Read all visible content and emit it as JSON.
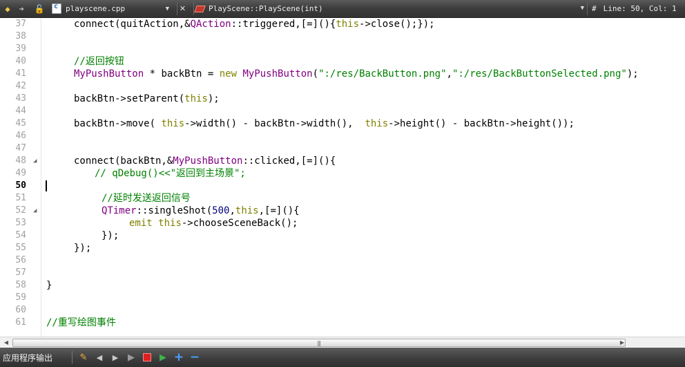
{
  "toolbar": {
    "file_name": "playscene.cpp",
    "symbol": "PlayScene::PlayScene(int)",
    "hash": "#",
    "line_col": "Line: 50, Col: 1"
  },
  "editor": {
    "lines": [
      {
        "n": "37",
        "indent": 46,
        "parts": [
          {
            "t": "connect(quitAction,&",
            "c": "plain"
          },
          {
            "t": "QAction",
            "c": "cls"
          },
          {
            "t": "::triggered,[=](){",
            "c": "plain"
          },
          {
            "t": "this",
            "c": "kw"
          },
          {
            "t": "->close();});",
            "c": "plain"
          }
        ]
      },
      {
        "n": "38",
        "indent": 0,
        "parts": []
      },
      {
        "n": "39",
        "indent": 0,
        "parts": []
      },
      {
        "n": "40",
        "indent": 46,
        "parts": [
          {
            "t": "//返回按钮",
            "c": "cmt"
          }
        ]
      },
      {
        "n": "41",
        "indent": 46,
        "parts": [
          {
            "t": "MyPushButton",
            "c": "cls"
          },
          {
            "t": " * backBtn = ",
            "c": "plain"
          },
          {
            "t": "new",
            "c": "kw"
          },
          {
            "t": " ",
            "c": "plain"
          },
          {
            "t": "MyPushButton",
            "c": "cls"
          },
          {
            "t": "(",
            "c": "plain"
          },
          {
            "t": "\":/res/BackButton.png\"",
            "c": "str"
          },
          {
            "t": ",",
            "c": "plain"
          },
          {
            "t": "\":/res/BackButtonSelected.png\"",
            "c": "str"
          },
          {
            "t": ");",
            "c": "plain"
          }
        ]
      },
      {
        "n": "42",
        "indent": 0,
        "parts": []
      },
      {
        "n": "43",
        "indent": 46,
        "parts": [
          {
            "t": "backBtn->setParent(",
            "c": "plain"
          },
          {
            "t": "this",
            "c": "kw"
          },
          {
            "t": ");",
            "c": "plain"
          }
        ]
      },
      {
        "n": "44",
        "indent": 0,
        "parts": []
      },
      {
        "n": "45",
        "indent": 46,
        "parts": [
          {
            "t": "backBtn->move( ",
            "c": "plain"
          },
          {
            "t": "this",
            "c": "kw"
          },
          {
            "t": "->width() - backBtn->width(),  ",
            "c": "plain"
          },
          {
            "t": "this",
            "c": "kw"
          },
          {
            "t": "->height() - backBtn->height());",
            "c": "plain"
          }
        ]
      },
      {
        "n": "46",
        "indent": 0,
        "parts": []
      },
      {
        "n": "47",
        "indent": 0,
        "parts": []
      },
      {
        "n": "48",
        "indent": 46,
        "fold": "◢",
        "parts": [
          {
            "t": "connect(backBtn,&",
            "c": "plain"
          },
          {
            "t": "MyPushButton",
            "c": "cls"
          },
          {
            "t": "::clicked,[=](){",
            "c": "plain"
          }
        ]
      },
      {
        "n": "49",
        "indent": 76,
        "parts": [
          {
            "t": "// qDebug()<<\"返回到主场景\";",
            "c": "cmt"
          }
        ]
      },
      {
        "n": "50",
        "indent": 0,
        "cursor": true,
        "parts": []
      },
      {
        "n": "51",
        "indent": 86,
        "parts": [
          {
            "t": "//延时发送返回信号",
            "c": "cmt"
          }
        ]
      },
      {
        "n": "52",
        "indent": 86,
        "fold": "◢",
        "parts": [
          {
            "t": "QTimer",
            "c": "cls"
          },
          {
            "t": "::singleShot(",
            "c": "plain"
          },
          {
            "t": "500",
            "c": "num"
          },
          {
            "t": ",",
            "c": "plain"
          },
          {
            "t": "this",
            "c": "kw"
          },
          {
            "t": ",[=](){",
            "c": "plain"
          }
        ]
      },
      {
        "n": "53",
        "indent": 126,
        "parts": [
          {
            "t": "emit",
            "c": "kw"
          },
          {
            "t": " ",
            "c": "plain"
          },
          {
            "t": "this",
            "c": "kw"
          },
          {
            "t": "->chooseSceneBack();",
            "c": "plain"
          }
        ]
      },
      {
        "n": "54",
        "indent": 86,
        "parts": [
          {
            "t": "});",
            "c": "plain"
          }
        ]
      },
      {
        "n": "55",
        "indent": 46,
        "parts": [
          {
            "t": "});",
            "c": "plain"
          }
        ]
      },
      {
        "n": "56",
        "indent": 0,
        "parts": []
      },
      {
        "n": "57",
        "indent": 0,
        "parts": []
      },
      {
        "n": "58",
        "indent": 6,
        "parts": [
          {
            "t": "}",
            "c": "plain"
          }
        ]
      },
      {
        "n": "59",
        "indent": 0,
        "parts": []
      },
      {
        "n": "60",
        "indent": 0,
        "parts": []
      },
      {
        "n": "61",
        "indent": 6,
        "parts": [
          {
            "t": "//重写绘图事件",
            "c": "cmt"
          }
        ]
      }
    ]
  },
  "scrollbar": {
    "grip": "|||"
  },
  "output_pane": {
    "title": "应用程序输出"
  },
  "colors": {
    "keyword": "#808000",
    "class": "#800080",
    "string": "#008000",
    "comment": "#008000",
    "number": "#000080"
  }
}
